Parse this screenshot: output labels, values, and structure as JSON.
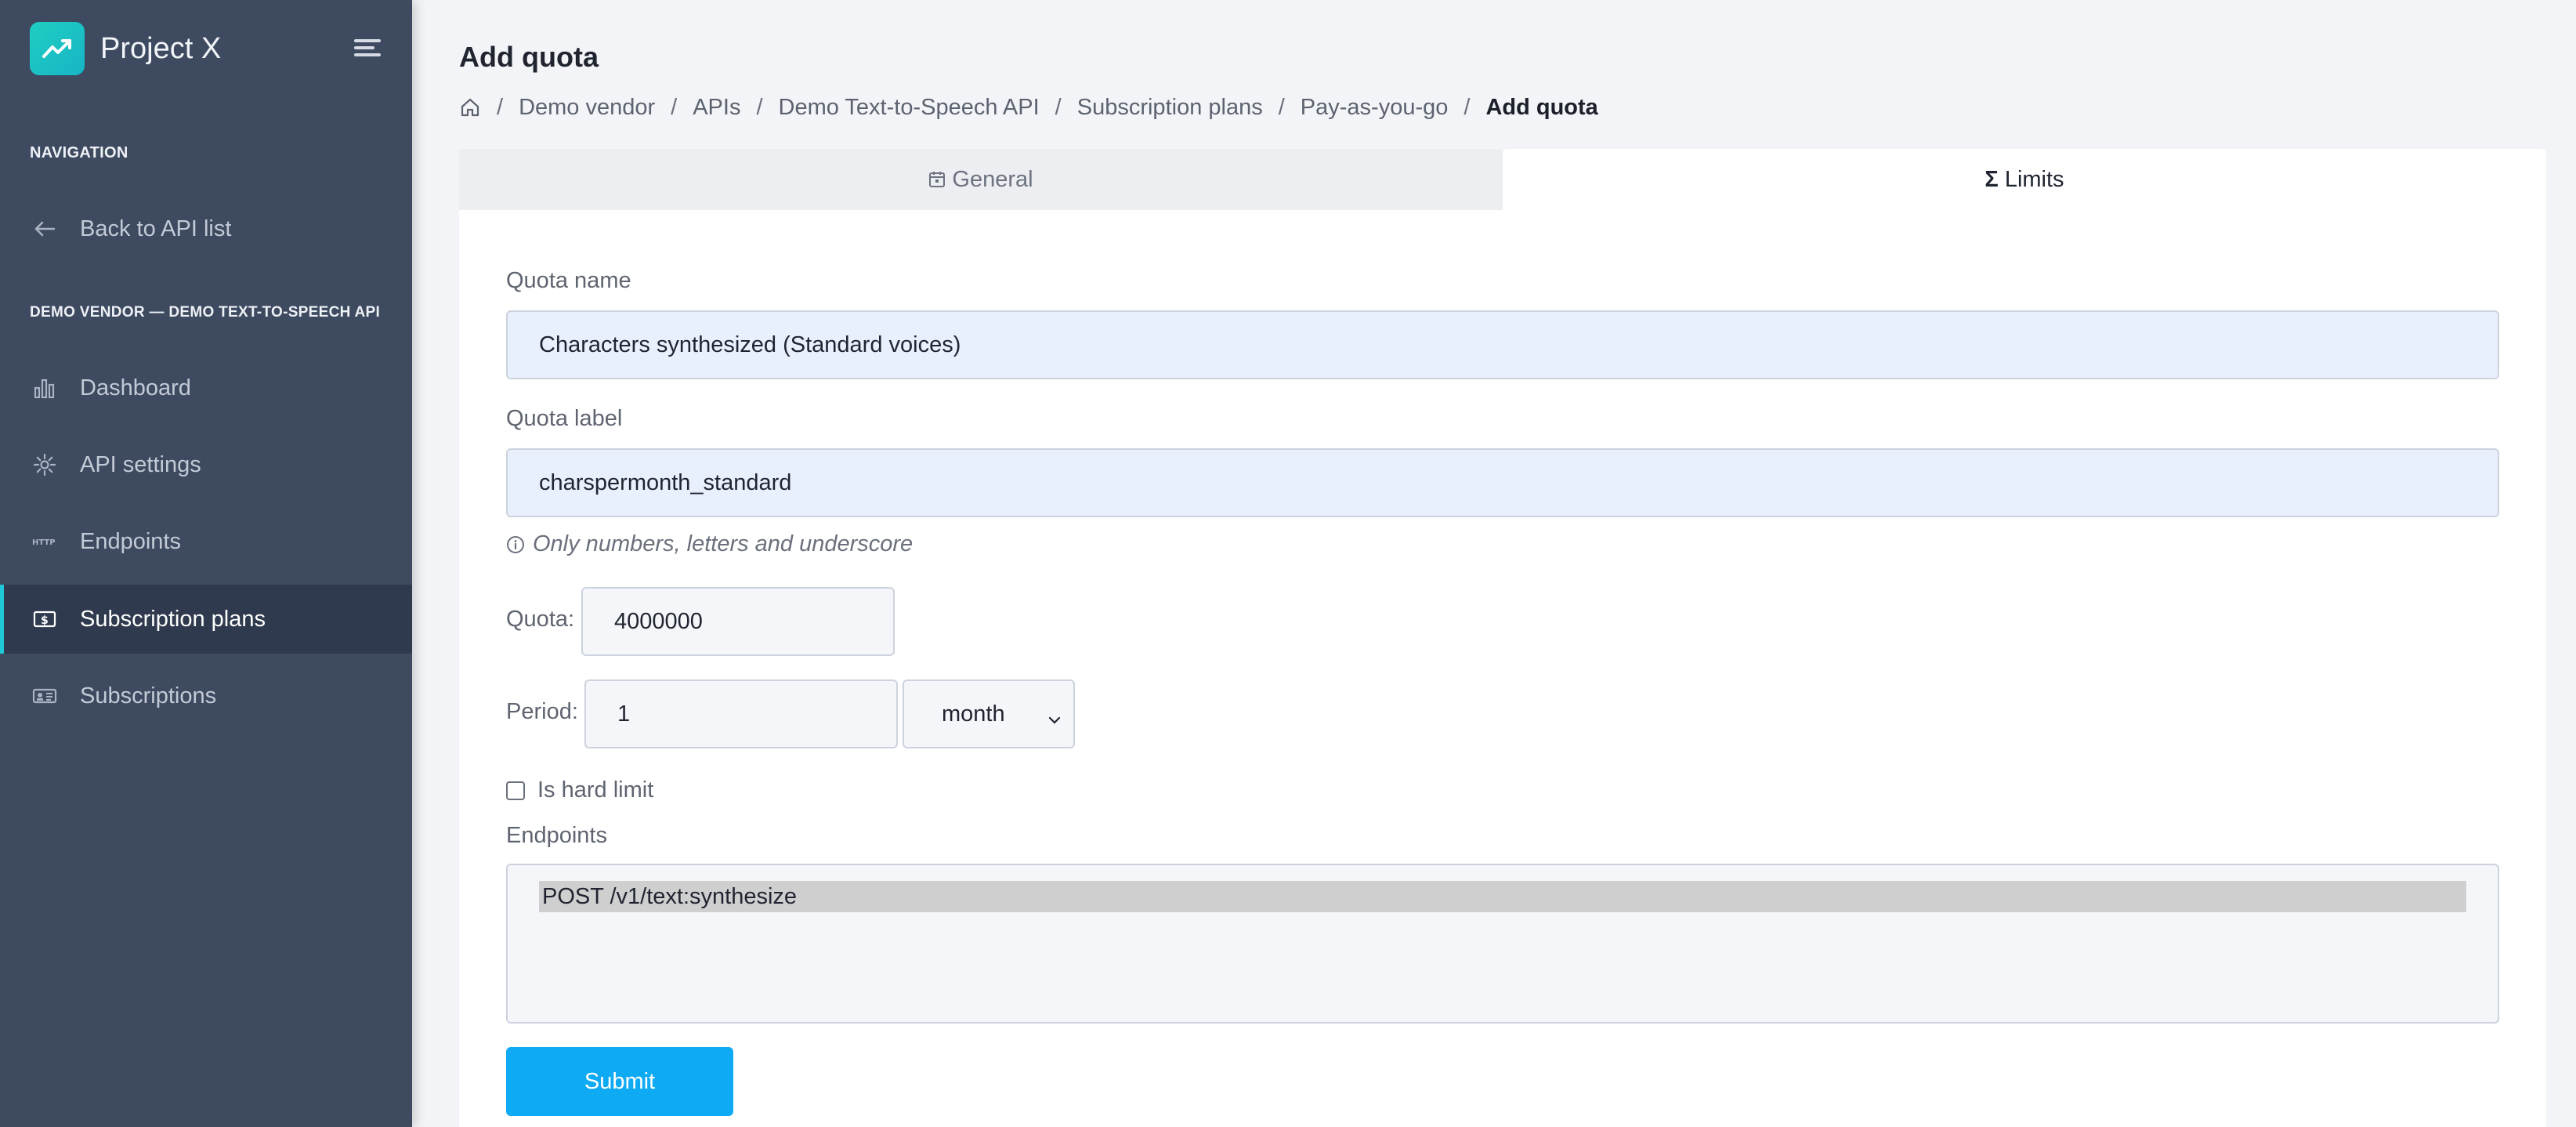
{
  "app": {
    "title": "Project X"
  },
  "sidebar": {
    "navigation_heading": "NAVIGATION",
    "back_label": "Back to API list",
    "api_heading": "DEMO VENDOR — DEMO TEXT-TO-SPEECH API",
    "items": [
      {
        "label": "Dashboard",
        "icon": "bar-chart-icon",
        "active": false
      },
      {
        "label": "API settings",
        "icon": "gear-icon",
        "active": false
      },
      {
        "label": "Endpoints",
        "icon": "http-icon",
        "active": false
      },
      {
        "label": "Subscription plans",
        "icon": "dollar-card-icon",
        "active": true
      },
      {
        "label": "Subscriptions",
        "icon": "id-card-icon",
        "active": false
      }
    ],
    "accent_color": "#1ec8d6"
  },
  "page": {
    "title": "Add quota",
    "breadcrumb": [
      "Demo vendor",
      "APIs",
      "Demo Text-to-Speech API",
      "Subscription plans",
      "Pay-as-you-go",
      "Add quota"
    ]
  },
  "tabs": [
    {
      "label": "General",
      "icon": "calendar-icon",
      "active": false
    },
    {
      "label": "Limits",
      "icon": "sigma-icon",
      "active": true
    }
  ],
  "form": {
    "quota_name_label": "Quota name",
    "quota_name_value": "Characters synthesized (Standard voices)",
    "quota_label_label": "Quota label",
    "quota_label_value": "charspermonth_standard",
    "quota_label_hint": "Only numbers, letters and underscore",
    "quota_amount_label": "Quota:",
    "quota_amount_value": "4000000",
    "period_label": "Period:",
    "period_value": "1",
    "period_unit": "month",
    "hard_limit_label": "Is hard limit",
    "hard_limit_checked": false,
    "endpoints_label": "Endpoints",
    "endpoints_selected": [
      "POST /v1/text:synthesize"
    ],
    "submit_label": "Submit",
    "submit_color": "#0eaaf3"
  }
}
